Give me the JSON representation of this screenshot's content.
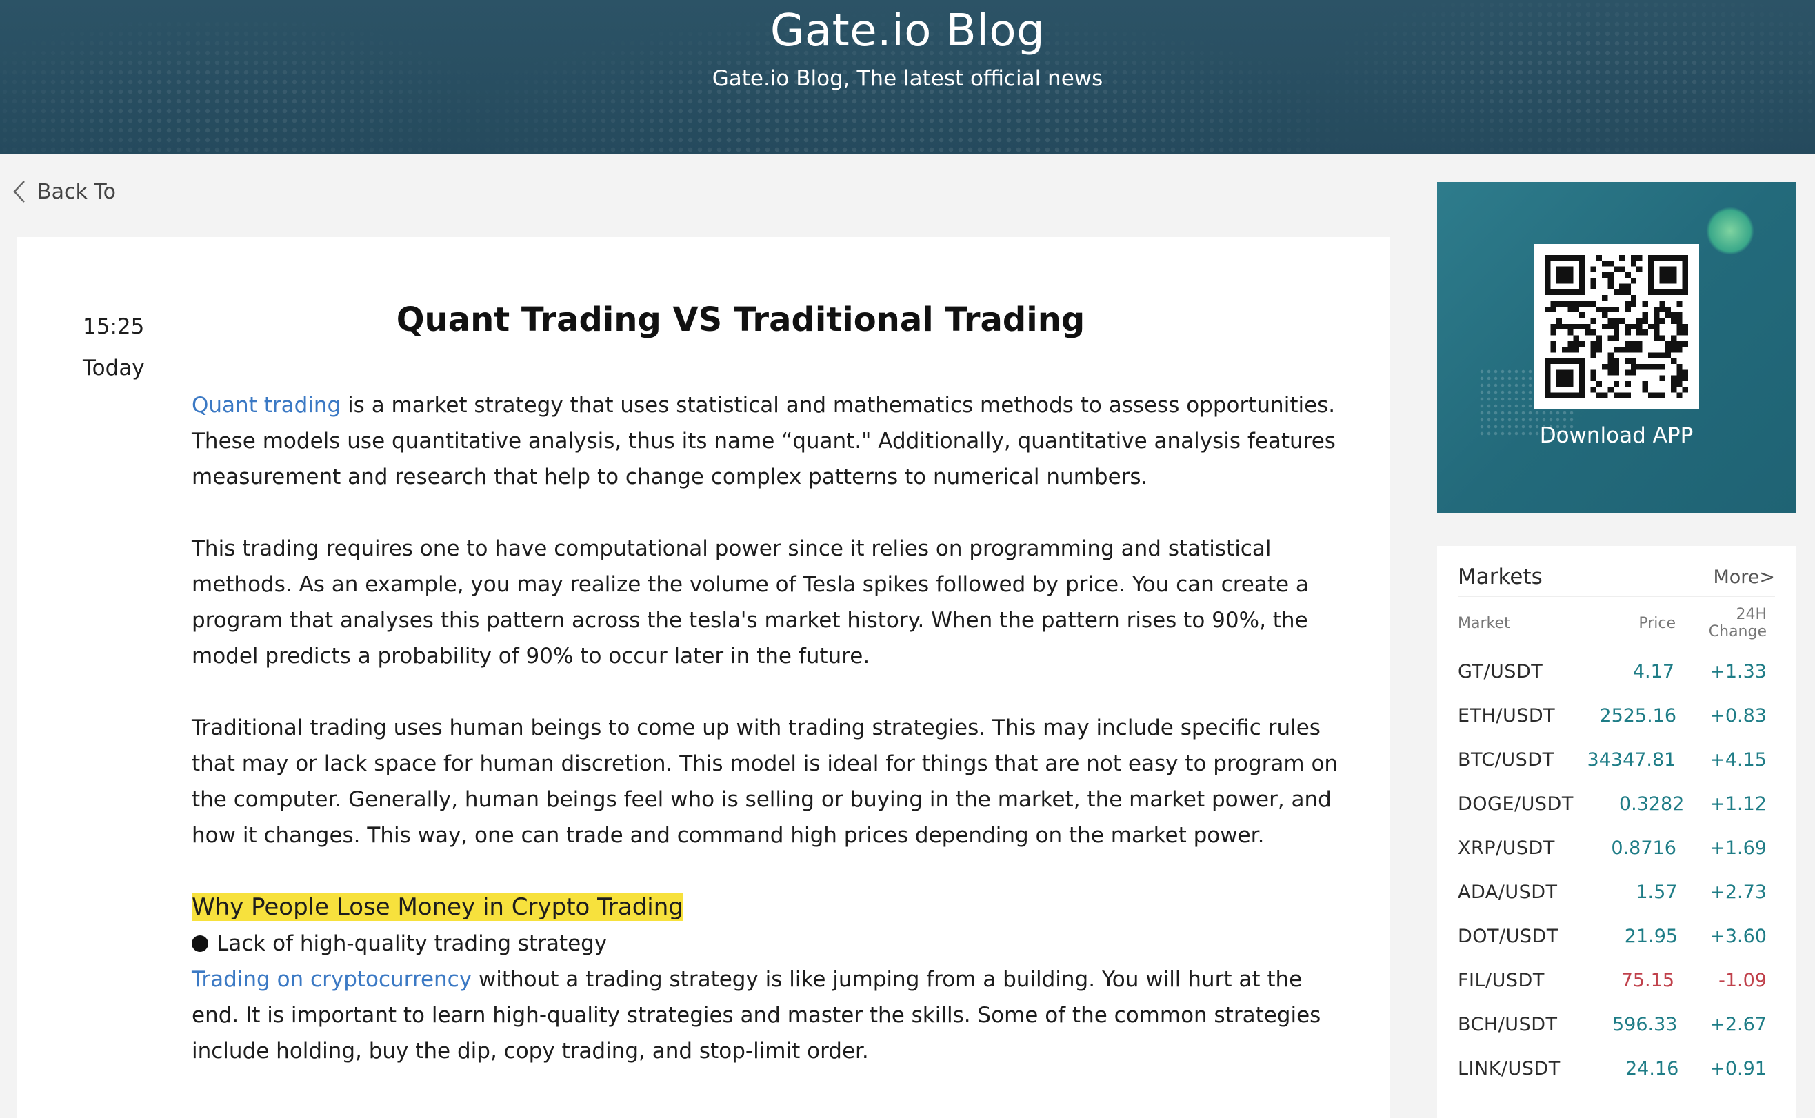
{
  "header": {
    "title": "Gate.io Blog",
    "subtitle": "Gate.io Blog, The latest official news"
  },
  "nav": {
    "back_label": "Back To",
    "back_icon": "chevron-left-icon"
  },
  "article": {
    "time": "15:25",
    "day": "Today",
    "title": "Quant Trading VS Traditional Trading",
    "p1_link": "Quant trading",
    "p1_text": " is a market strategy that uses statistical and mathematics methods to assess opportunities. These models use quantitative analysis, thus its name “quant.\" Additionally, quantitative analysis features measurement and research that help to change complex patterns to numerical numbers.",
    "p2_text": "This trading requires one to have computational power since it relies on programming and statistical methods. As an example, you may realize the volume of Tesla spikes followed by price. You can create a program that analyses this pattern across the tesla's market history. When the pattern rises to 90%, the model predicts a probability of 90% to occur later in the future.",
    "p3_text": "Traditional trading uses human beings to come up with trading strategies. This may include specific rules that may or lack space for human discretion. This model is ideal for things that are not easy to program on the computer. Generally, human beings feel who is selling or buying in the market, the market power, and how it changes. This way, one can trade and command high prices depending on the market power.",
    "section_heading": "Why People Lose Money in Crypto Trading",
    "bullet1": "Lack of high-quality trading strategy",
    "p4_link": "Trading on cryptocurrency",
    "p4_text": " without a trading strategy is like jumping from a building. You will hurt at the end. It is important to learn high-quality strategies and master the skills. Some of the common strategies include holding, buy the dip, copy trading, and stop-limit order."
  },
  "app_card": {
    "download_label": "Download APP",
    "qr_icon": "qr-code-icon",
    "accent": "#2e7c8c"
  },
  "markets": {
    "title": "Markets",
    "more_label": "More>",
    "col_market": "Market",
    "col_price": "Price",
    "col_change": "24H Change",
    "up_color": "#1e7c86",
    "down_color": "#c0414b",
    "rows": [
      {
        "market": "GT/USDT",
        "price": "4.17",
        "change": "+1.33",
        "dir": "up"
      },
      {
        "market": "ETH/USDT",
        "price": "2525.16",
        "change": "+0.83",
        "dir": "up"
      },
      {
        "market": "BTC/USDT",
        "price": "34347.81",
        "change": "+4.15",
        "dir": "up"
      },
      {
        "market": "DOGE/USDT",
        "price": "0.3282",
        "change": "+1.12",
        "dir": "up"
      },
      {
        "market": "XRP/USDT",
        "price": "0.8716",
        "change": "+1.69",
        "dir": "up"
      },
      {
        "market": "ADA/USDT",
        "price": "1.57",
        "change": "+2.73",
        "dir": "up"
      },
      {
        "market": "DOT/USDT",
        "price": "21.95",
        "change": "+3.60",
        "dir": "up"
      },
      {
        "market": "FIL/USDT",
        "price": "75.15",
        "change": "-1.09",
        "dir": "down"
      },
      {
        "market": "BCH/USDT",
        "price": "596.33",
        "change": "+2.67",
        "dir": "up"
      },
      {
        "market": "LINK/USDT",
        "price": "24.16",
        "change": "+0.91",
        "dir": "up"
      }
    ]
  }
}
